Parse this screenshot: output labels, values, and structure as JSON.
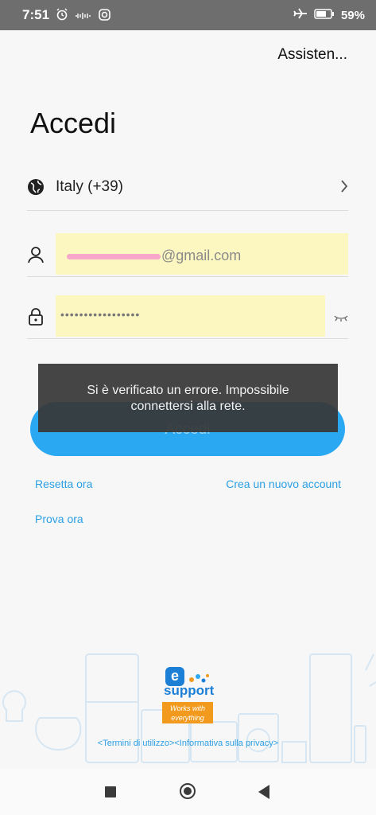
{
  "status_bar": {
    "time": "7:51",
    "battery": "59%",
    "icons_left": [
      "alarm-icon",
      "sound-wave-icon",
      "instagram-icon"
    ],
    "icons_right": [
      "airplane-icon",
      "battery-icon"
    ]
  },
  "header": {
    "assist_label": "Assisten..."
  },
  "page": {
    "title": "Accedi"
  },
  "country": {
    "label": "Italy (+39)",
    "icon": "globe-icon"
  },
  "email": {
    "visible_suffix": "@gmail.com",
    "icon": "user-icon"
  },
  "password": {
    "value": "•••••••••••••••••",
    "icon": "lock-icon"
  },
  "login_button": {
    "label": "Accedi"
  },
  "toast": {
    "message": "Si è verificato un errore. Impossibile connettersi alla rete."
  },
  "links": {
    "reset": "Resetta ora",
    "create": "Crea un nuovo account",
    "try": "Prova ora"
  },
  "logo": {
    "letter": "e",
    "brand": "support",
    "tagline": "Works with everything"
  },
  "legal": "<Termini di utilizzo><Informativa sulla privacy>",
  "colors": {
    "accent": "#2aa8f2",
    "link": "#2b9fe4",
    "autofill": "#fcf7c0",
    "badge": "#f29a1e"
  }
}
